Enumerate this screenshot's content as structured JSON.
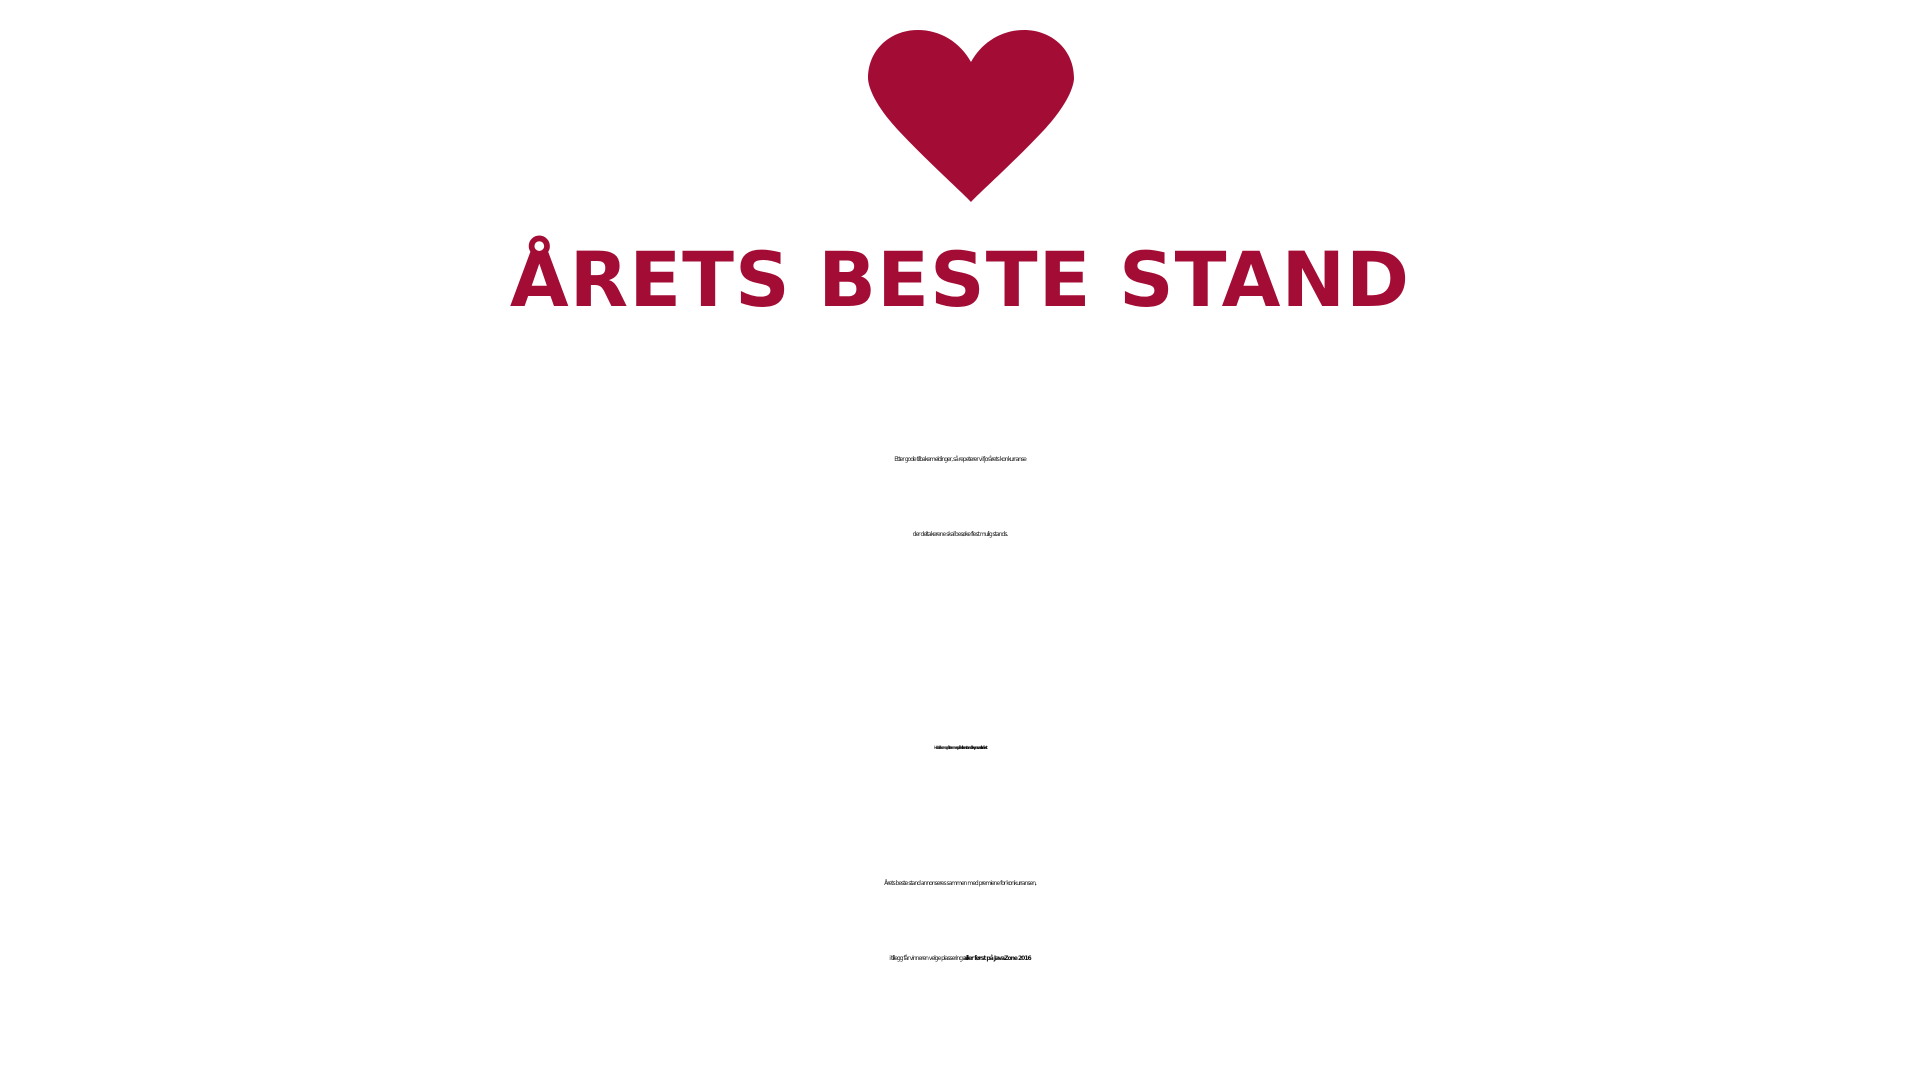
{
  "colors": {
    "accent": "#a30d35",
    "text": "#222222"
  },
  "icon": "heart-icon",
  "title": "ÅRETS BESTE STAND",
  "paragraph1": {
    "line1": "Etter gode tilbakemeldinger, så repeterer vi fjorårets konkurranse",
    "line2": "der deltakerene skal besøke flest mulig stands."
  },
  "paragraph2": {
    "text": "Her skal deltakerene også ",
    "emphasis": "stemme på hvilken stand de syns var aller råest"
  },
  "paragraph3": {
    "line1": "Årets beste stand annonseres sammen med premiene for konkurransen,",
    "line2_text": "i tillegg får vinneren velge plassering ",
    "line2_emphasis": "aller først på JavaZone 2016"
  }
}
